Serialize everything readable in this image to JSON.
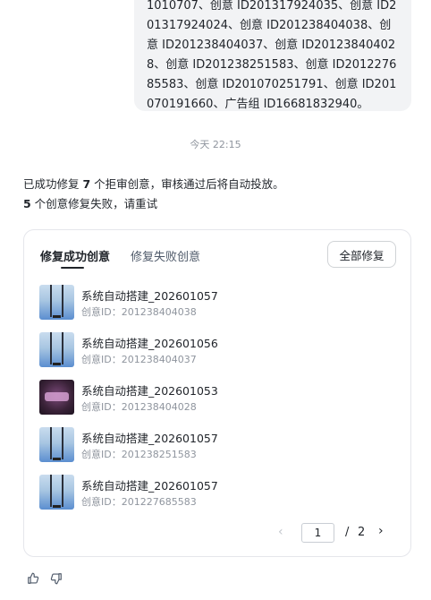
{
  "chat": {
    "bubble_text": "1010707、创意 ID201317924035、创意 ID201317924024、创意 ID201238404038、创意 ID201238404037、创意 ID201238404028、创意 ID201238251583、创意 ID201227685583、创意 ID201070251791、创意 ID201070191660、广告组 ID16681832940。",
    "timestamp": "今天 22:15"
  },
  "result": {
    "line1_prefix": "已成功修复 ",
    "line1_count": "7",
    "line1_suffix": " 个拒审创意，审核通过后将自动投放。",
    "line2_count": "5",
    "line2_suffix": " 个创意修复失败，请重试"
  },
  "panel": {
    "tabs": [
      {
        "label": "修复成功创意",
        "active": true
      },
      {
        "label": "修复失败创意",
        "active": false
      }
    ],
    "repair_all_label": "全部修复",
    "items": [
      {
        "title": "系统自动搭建_202601057",
        "creative_id": "创意ID：201238404038",
        "thumb": "blue-bars"
      },
      {
        "title": "系统自动搭建_202601056",
        "creative_id": "创意ID：201238404037",
        "thumb": "blue-bars"
      },
      {
        "title": "系统自动搭建_202601053",
        "creative_id": "创意ID：201238404028",
        "thumb": "purple-glow"
      },
      {
        "title": "系统自动搭建_202601057",
        "creative_id": "创意ID：201238251583",
        "thumb": "blue-bars"
      },
      {
        "title": "系统自动搭建_202601057",
        "creative_id": "创意ID：201227685583",
        "thumb": "blue-bars"
      }
    ],
    "pagination": {
      "current_page": "1",
      "separator": "/",
      "total_pages": "2",
      "prev_icon": "chevron-left-icon",
      "next_icon": "chevron-right-icon"
    }
  },
  "feedback": {
    "like_icon": "thumbs-up-icon",
    "dislike_icon": "thumbs-down-icon"
  },
  "colors": {
    "bubble_bg": "#f2f3f5",
    "text_primary": "#1f2329",
    "text_secondary": "#8f959e",
    "border": "#e5e6eb"
  }
}
